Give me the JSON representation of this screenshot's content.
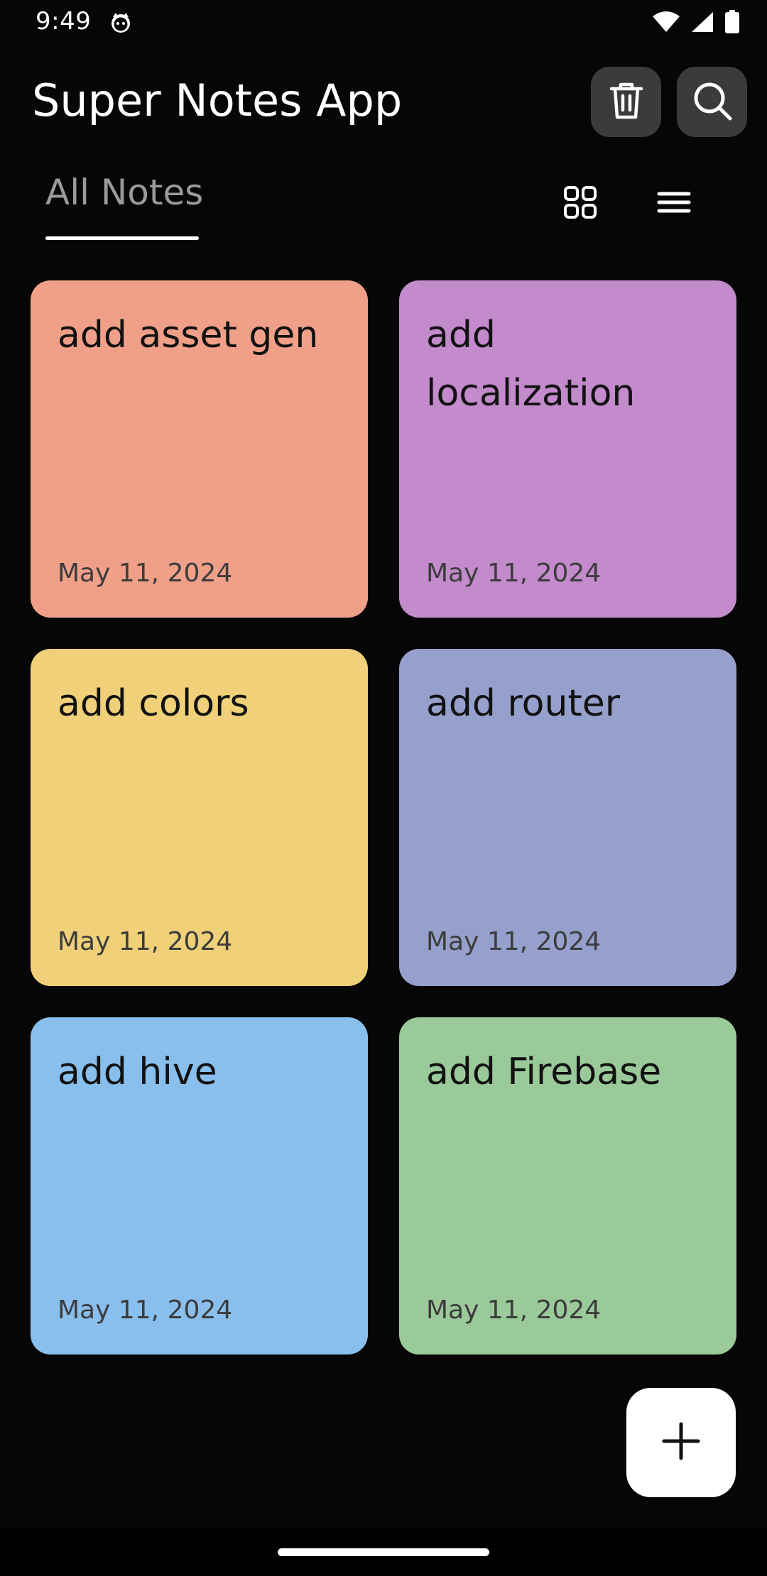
{
  "status_bar": {
    "time": "9:49",
    "notification_icon": "cat-face-icon",
    "icons": [
      "wifi-icon",
      "cellular-signal-icon",
      "battery-icon"
    ]
  },
  "app_bar": {
    "title": "Super Notes App",
    "actions": [
      {
        "name": "delete",
        "icon": "trash-icon"
      },
      {
        "name": "search",
        "icon": "search-icon"
      }
    ]
  },
  "tabs": {
    "active": "All Notes",
    "items": [
      {
        "label": "All Notes"
      }
    ]
  },
  "view_toggles": {
    "grid_icon": "grid-view-icon",
    "list_icon": "list-view-icon"
  },
  "notes": [
    {
      "title": "add asset gen",
      "date": "May 11, 2024",
      "color": "#F0A088"
    },
    {
      "title": "add localization",
      "date": "May 11, 2024",
      "color": "#C38ACC"
    },
    {
      "title": "add colors",
      "date": "May 11, 2024",
      "color": "#F0D17A"
    },
    {
      "title": "add router",
      "date": "May 11, 2024",
      "color": "#96A0CD"
    },
    {
      "title": "add hive",
      "date": "May 11, 2024",
      "color": "#89BFEC"
    },
    {
      "title": "add Firebase",
      "date": "May 11, 2024",
      "color": "#9BCA9A"
    }
  ],
  "fab": {
    "icon": "plus-icon"
  },
  "colors": {
    "background": "#060606",
    "icon_button_bg": "#3B3B3B",
    "tab_inactive_text": "#9A9A9A",
    "fab_bg": "#FFFFFF"
  }
}
